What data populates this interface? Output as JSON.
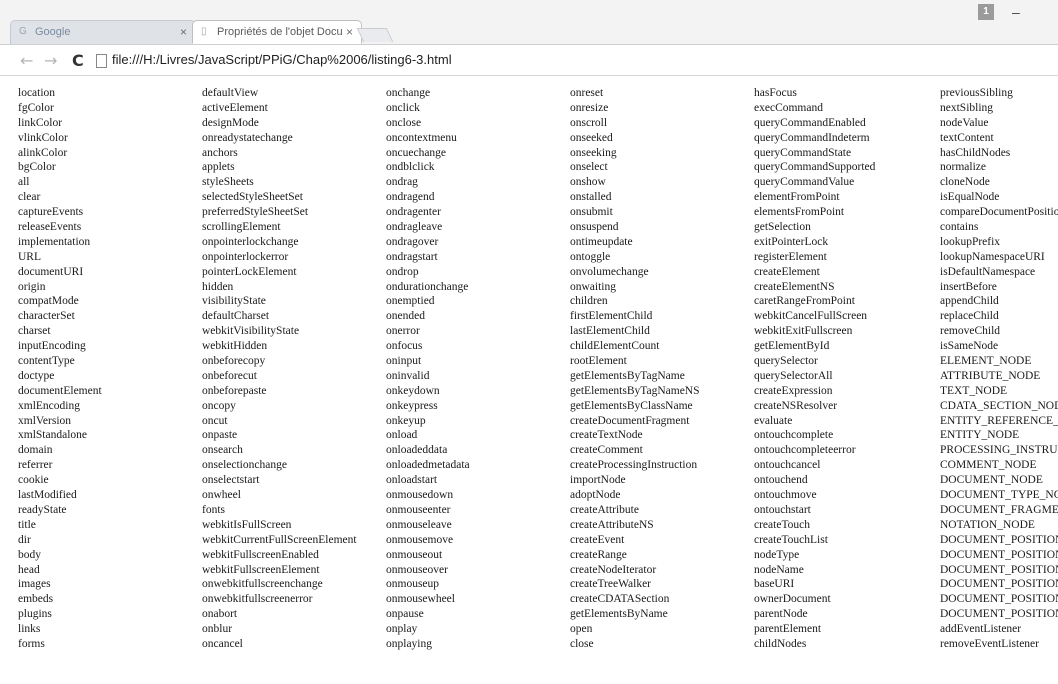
{
  "tabs": [
    {
      "label": "Google",
      "icon": "google-favicon",
      "close": "×"
    },
    {
      "label": "Propriétés de l'objet Docu",
      "icon": "page-favicon",
      "close": "×"
    }
  ],
  "window": {
    "avatar": "1",
    "minimize": "–"
  },
  "toolbar": {
    "back": "←",
    "forward": "→",
    "reload": "C",
    "url": "file:///H:/Livres/JavaScript/PPiG/Chap%2006/listing6-3.html"
  },
  "columns": [
    [
      "location",
      "fgColor",
      "linkColor",
      "vlinkColor",
      "alinkColor",
      "bgColor",
      "all",
      "clear",
      "captureEvents",
      "releaseEvents",
      "implementation",
      "URL",
      "documentURI",
      "origin",
      "compatMode",
      "characterSet",
      "charset",
      "inputEncoding",
      "contentType",
      "doctype",
      "documentElement",
      "xmlEncoding",
      "xmlVersion",
      "xmlStandalone",
      "domain",
      "referrer",
      "cookie",
      "lastModified",
      "readyState",
      "title",
      "dir",
      "body",
      "head",
      "images",
      "embeds",
      "plugins",
      "links",
      "forms"
    ],
    [
      "defaultView",
      "activeElement",
      "designMode",
      "onreadystatechange",
      "anchors",
      "applets",
      "styleSheets",
      "selectedStyleSheetSet",
      "preferredStyleSheetSet",
      "scrollingElement",
      "onpointerlockchange",
      "onpointerlockerror",
      "pointerLockElement",
      "hidden",
      "visibilityState",
      "defaultCharset",
      "webkitVisibilityState",
      "webkitHidden",
      "onbeforecopy",
      "onbeforecut",
      "onbeforepaste",
      "oncopy",
      "oncut",
      "onpaste",
      "onsearch",
      "onselectionchange",
      "onselectstart",
      "onwheel",
      "fonts",
      "webkitIsFullScreen",
      "webkitCurrentFullScreenElement",
      "webkitFullscreenEnabled",
      "webkitFullscreenElement",
      "onwebkitfullscreenchange",
      "onwebkitfullscreenerror",
      "onabort",
      "onblur",
      "oncancel"
    ],
    [
      "onchange",
      "onclick",
      "onclose",
      "oncontextmenu",
      "oncuechange",
      "ondblclick",
      "ondrag",
      "ondragend",
      "ondragenter",
      "ondragleave",
      "ondragover",
      "ondragstart",
      "ondrop",
      "ondurationchange",
      "onemptied",
      "onended",
      "onerror",
      "onfocus",
      "oninput",
      "oninvalid",
      "onkeydown",
      "onkeypress",
      "onkeyup",
      "onload",
      "onloadeddata",
      "onloadedmetadata",
      "onloadstart",
      "onmousedown",
      "onmouseenter",
      "onmouseleave",
      "onmousemove",
      "onmouseout",
      "onmouseover",
      "onmouseup",
      "onmousewheel",
      "onpause",
      "onplay",
      "onplaying"
    ],
    [
      "onreset",
      "onresize",
      "onscroll",
      "onseeked",
      "onseeking",
      "onselect",
      "onshow",
      "onstalled",
      "onsubmit",
      "onsuspend",
      "ontimeupdate",
      "ontoggle",
      "onvolumechange",
      "onwaiting",
      "children",
      "firstElementChild",
      "lastElementChild",
      "childElementCount",
      "rootElement",
      "getElementsByTagName",
      "getElementsByTagNameNS",
      "getElementsByClassName",
      "createDocumentFragment",
      "createTextNode",
      "createComment",
      "createProcessingInstruction",
      "importNode",
      "adoptNode",
      "createAttribute",
      "createAttributeNS",
      "createEvent",
      "createRange",
      "createNodeIterator",
      "createTreeWalker",
      "createCDATASection",
      "getElementsByName",
      "open",
      "close"
    ],
    [
      "hasFocus",
      "execCommand",
      "queryCommandEnabled",
      "queryCommandIndeterm",
      "queryCommandState",
      "queryCommandSupported",
      "queryCommandValue",
      "elementFromPoint",
      "elementsFromPoint",
      "getSelection",
      "exitPointerLock",
      "registerElement",
      "createElement",
      "createElementNS",
      "caretRangeFromPoint",
      "webkitCancelFullScreen",
      "webkitExitFullscreen",
      "getElementById",
      "querySelector",
      "querySelectorAll",
      "createExpression",
      "createNSResolver",
      "evaluate",
      "ontouchcomplete",
      "ontouchcompleteerror",
      "ontouchcancel",
      "ontouchend",
      "ontouchmove",
      "ontouchstart",
      "createTouch",
      "createTouchList",
      "nodeType",
      "nodeName",
      "baseURI",
      "ownerDocument",
      "parentNode",
      "parentElement",
      "childNodes"
    ],
    [
      "previousSibling",
      "nextSibling",
      "nodeValue",
      "textContent",
      "hasChildNodes",
      "normalize",
      "cloneNode",
      "isEqualNode",
      "compareDocumentPosition",
      "contains",
      "lookupPrefix",
      "lookupNamespaceURI",
      "isDefaultNamespace",
      "insertBefore",
      "appendChild",
      "replaceChild",
      "removeChild",
      "isSameNode",
      "ELEMENT_NODE",
      "ATTRIBUTE_NODE",
      "TEXT_NODE",
      "CDATA_SECTION_NODE",
      "ENTITY_REFERENCE_NODE",
      "ENTITY_NODE",
      "PROCESSING_INSTRUCTION_NODE",
      "COMMENT_NODE",
      "DOCUMENT_NODE",
      "DOCUMENT_TYPE_NODE",
      "DOCUMENT_FRAGMENT_NODE",
      "NOTATION_NODE",
      "DOCUMENT_POSITION_DISCONNECTED",
      "DOCUMENT_POSITION_PRECEDING",
      "DOCUMENT_POSITION_FOLLOWING",
      "DOCUMENT_POSITION_CONTAINS",
      "DOCUMENT_POSITION_CONTAINED_BY",
      "DOCUMENT_POSITION_IMPLEMENTATION_SPECIFIC",
      "addEventListener",
      "removeEventListener"
    ]
  ]
}
